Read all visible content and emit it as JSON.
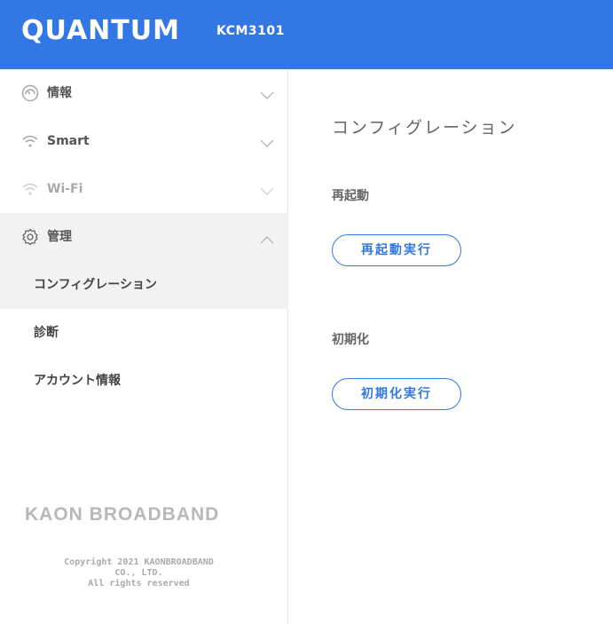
{
  "header": {
    "logo": "QUANTUM",
    "model": "KCM3101",
    "bg_color": "#3277e3"
  },
  "sidebar": {
    "menus": [
      {
        "label": "情報",
        "icon": "gauge-icon",
        "expanded": false
      },
      {
        "label": "Smart",
        "icon": "wifi-icon",
        "expanded": false
      },
      {
        "label": "Wi-Fi",
        "icon": "wifi-icon",
        "expanded": false
      },
      {
        "label": "管理",
        "icon": "gear-icon",
        "expanded": true
      }
    ],
    "submenu": [
      {
        "label": "コンフィグレーション",
        "selected": true
      },
      {
        "label": "診断",
        "selected": false
      },
      {
        "label": "アカウント情報",
        "selected": false
      }
    ],
    "brand": "KAON BROADBAND",
    "copyright": {
      "line1": "Copyright 2021 KAONBROADBAND",
      "line2": "CO., LTD.",
      "line3": "All rights reserved"
    }
  },
  "main": {
    "title": "コンフィグレーション",
    "sections": [
      {
        "title": "再起動",
        "button": "再起動実行"
      },
      {
        "title": "初期化",
        "button": "初期化実行"
      }
    ]
  },
  "colors": {
    "accent": "#3277e3",
    "selected_bg": "#f2f2f2"
  }
}
